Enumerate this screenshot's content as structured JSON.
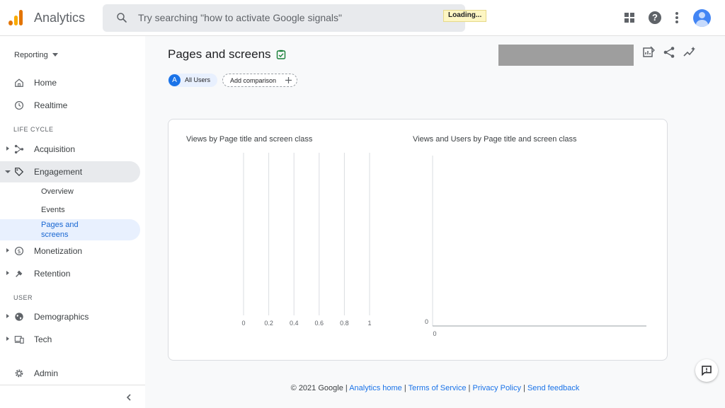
{
  "header": {
    "app_title": "Analytics",
    "search_placeholder": "Try searching \"how to activate Google signals\"",
    "loading": "Loading..."
  },
  "sidebar": {
    "reporting": "Reporting",
    "home": "Home",
    "realtime": "Realtime",
    "section_lifecycle": "LIFE CYCLE",
    "acquisition": "Acquisition",
    "engagement": "Engagement",
    "engagement_children": [
      "Overview",
      "Events",
      "Pages and",
      "screens"
    ],
    "monetization": "Monetization",
    "retention": "Retention",
    "section_user": "USER",
    "demographics": "Demographics",
    "tech": "Tech",
    "admin": "Admin"
  },
  "main": {
    "page_title": "Pages and screens",
    "comparison_letter": "A",
    "comparison_label": "All Users",
    "add_comparison": "Add comparison"
  },
  "chart_data": [
    {
      "type": "bar",
      "title": "Views by Page title and screen class",
      "categories": [],
      "values": [],
      "x_ticks": [
        "0",
        "0.2",
        "0.4",
        "0.6",
        "0.8",
        "1"
      ],
      "xlim": [
        0,
        1
      ],
      "grid": true
    },
    {
      "type": "scatter",
      "title": "Views and Users by Page title and screen class",
      "x": [],
      "y": [],
      "x_ticks": [
        "0"
      ],
      "y_ticks": [
        "0"
      ]
    }
  ],
  "footer": {
    "copyright": "© 2021 Google",
    "sep": " | ",
    "links": [
      "Analytics home",
      "Terms of Service",
      "Privacy Policy",
      "Send feedback"
    ]
  },
  "icons": {
    "accent": "#1a73e8",
    "brand_orange": "#e37400",
    "brand_yellow": "#f9ab00",
    "check_green": "#188038"
  }
}
